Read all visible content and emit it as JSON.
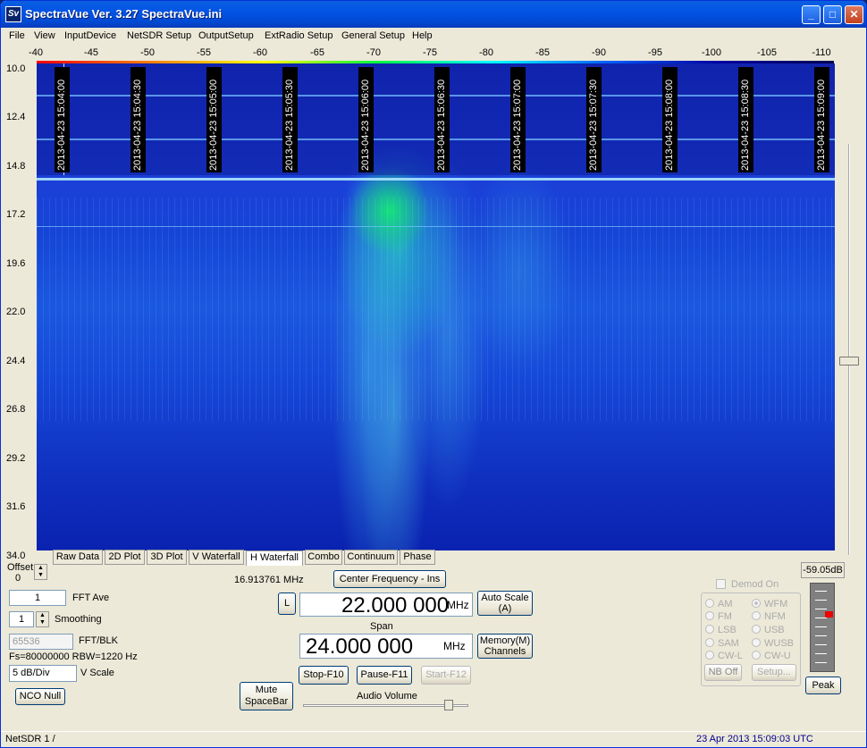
{
  "window": {
    "title": "SpectraVue Ver. 3.27  SpectraVue.ini",
    "icon": "Sv",
    "minimize": "_",
    "maximize": "□",
    "close": "✕"
  },
  "menu": [
    "File",
    "View",
    "InputDevice",
    "NetSDR Setup",
    "OutputSetup",
    "ExtRadio Setup",
    "General Setup",
    "Help"
  ],
  "freq_scale": [
    "-40",
    "-45",
    "-50",
    "-55",
    "-60",
    "-65",
    "-70",
    "-75",
    "-80",
    "-85",
    "-90",
    "-95",
    "-100",
    "-105",
    "-110"
  ],
  "y_axis": [
    "10.0",
    "12.4",
    "14.8",
    "17.2",
    "19.6",
    "22.0",
    "24.4",
    "26.8",
    "29.2",
    "31.6",
    "34.0"
  ],
  "timestamps": [
    "2013-04-23 15:04:00",
    "2013-04-23 15:04:30",
    "2013-04-23 15:05:00",
    "2013-04-23 15:05:30",
    "2013-04-23 15:06:00",
    "2013-04-23 15:06:30",
    "2013-04-23 15:07:00",
    "2013-04-23 15:07:30",
    "2013-04-23 15:08:00",
    "2013-04-23 15:08:30",
    "2013-04-23 15:09:00"
  ],
  "tabs": [
    "Raw Data",
    "2D Plot",
    "3D Plot",
    "V Waterfall",
    "H Waterfall",
    "Combo",
    "Continuum",
    "Phase"
  ],
  "active_tab": "H Waterfall",
  "controls": {
    "offset_label": "Offset",
    "offset_value": "0",
    "fft_ave_value": "1",
    "fft_ave_label": "FFT Ave",
    "smoothing_value": "1",
    "smoothing_label": "Smoothing",
    "fft_blk_value": "65536",
    "fft_blk_label": "FFT/BLK",
    "fs_info": "Fs=80000000 RBW=1220 Hz",
    "vscale_value": "5 dB/Div",
    "vscale_label": "V Scale",
    "nco_null": "NCO Null",
    "cursor_freq": "16.913761 MHz",
    "center_freq_btn": "Center Frequency - Ins",
    "l_btn": "L",
    "center_freq": "22.000 000",
    "mhz1": "MHz",
    "auto_scale": "Auto Scale\n(A)",
    "span_label": "Span",
    "span": "24.000 000",
    "mhz2": "MHz",
    "memory": "Memory(M)\nChannels",
    "stop": "Stop-F10",
    "pause": "Pause-F11",
    "start": "Start-F12",
    "mute": "Mute\nSpaceBar",
    "audio_volume": "Audio Volume",
    "audio_volume_level": 0.88,
    "demod_on": "Demod On",
    "modes_left": [
      "AM",
      "FM",
      "LSB",
      "SAM",
      "CW-L"
    ],
    "modes_right": [
      "WFM",
      "NFM",
      "USB",
      "WUSB",
      "CW-U"
    ],
    "selected_mode": "WFM",
    "nb_off": "NB Off",
    "setup": "Setup...",
    "level": "-59.05dB",
    "peak": "Peak"
  },
  "status": {
    "left": "NetSDR 1  /",
    "right": "23 Apr 2013  15:09:03 UTC"
  },
  "colors": {
    "title_blue": "#0354e5",
    "waterfall_bg": "#1a40d8",
    "signal": "#20e080"
  }
}
